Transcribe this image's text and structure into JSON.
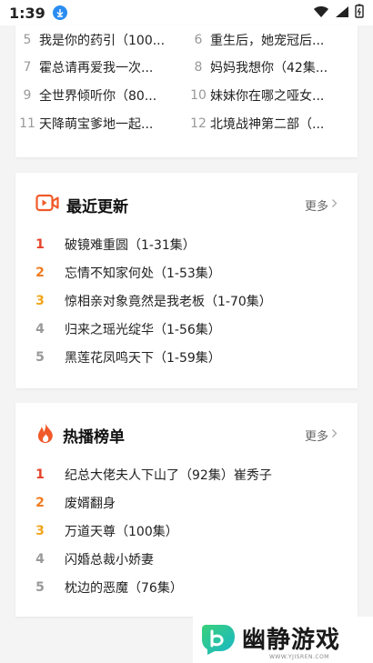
{
  "status_bar": {
    "time": "1:39"
  },
  "top_grid": [
    [
      {
        "num": "5",
        "title": "我是你的药引（100..."
      },
      {
        "num": "6",
        "title": "重生后，她宠冠后..."
      }
    ],
    [
      {
        "num": "7",
        "title": "霍总请再爱我一次..."
      },
      {
        "num": "8",
        "title": "妈妈我想你（42集..."
      }
    ],
    [
      {
        "num": "9",
        "title": "全世界倾听你（80..."
      },
      {
        "num": "10",
        "title": "妹妹你在哪之哑女..."
      }
    ],
    [
      {
        "num": "11",
        "title": "天降萌宝爹地一起..."
      },
      {
        "num": "12",
        "title": "北境战神第二部（..."
      }
    ]
  ],
  "recent": {
    "title": "最近更新",
    "more": "更多",
    "items": [
      {
        "rank": "1",
        "title": "破镜难重圆（1-31集）"
      },
      {
        "rank": "2",
        "title": "忘情不知家何处（1-53集）"
      },
      {
        "rank": "3",
        "title": "惊相亲对象竟然是我老板（1-70集）"
      },
      {
        "rank": "4",
        "title": "归来之瑶光绽华（1-56集）"
      },
      {
        "rank": "5",
        "title": "黑莲花凤鸣天下（1-59集）"
      }
    ]
  },
  "hot": {
    "title": "热播榜单",
    "more": "更多",
    "items": [
      {
        "rank": "1",
        "title": "纪总大佬夫人下山了（92集）崔秀子"
      },
      {
        "rank": "2",
        "title": "废婿翻身"
      },
      {
        "rank": "3",
        "title": "万道天尊（100集）"
      },
      {
        "rank": "4",
        "title": "闪婚总裁小娇妻"
      },
      {
        "rank": "5",
        "title": "枕边的恶魔（76集）"
      }
    ]
  },
  "watermark": {
    "text": "幽静游戏",
    "url": "WWW.YJISREN.COM"
  },
  "colors": {
    "rank1": "#e5432a",
    "rank2": "#f07b1f",
    "rank3": "#f2a51a",
    "accent": "#f05a28"
  },
  "icons": {
    "recent": "video-camera-icon",
    "hot": "flame-icon",
    "more": "chevron-right-icon"
  }
}
